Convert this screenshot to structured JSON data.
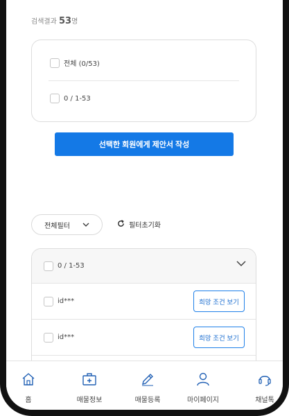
{
  "search_result": {
    "prefix": "검색결과",
    "count": "53",
    "suffix": "명"
  },
  "select_box": {
    "all_label": "전체 (0/53)",
    "range_label": "0 / 1-53"
  },
  "cta": {
    "label": "선택한 회원에게 제안서 작성"
  },
  "filter": {
    "label": "전체필터",
    "reset_label": "필터초기화"
  },
  "list": {
    "header": "0 / 1-53",
    "items": [
      {
        "id": "id***",
        "action": "희망 조건 보기"
      },
      {
        "id": "id***",
        "action": "희망 조건 보기"
      }
    ]
  },
  "bottom_nav": [
    {
      "label": "홈",
      "icon": "home-icon"
    },
    {
      "label": "매물정보",
      "icon": "briefcase-icon"
    },
    {
      "label": "매물등록",
      "icon": "pencil-icon"
    },
    {
      "label": "마이페이지",
      "icon": "user-icon"
    },
    {
      "label": "채널톡",
      "icon": "headset-icon"
    }
  ],
  "colors": {
    "primary": "#1479e6",
    "border": "#dcdcdc",
    "nav_icon": "#1f5fb4"
  }
}
